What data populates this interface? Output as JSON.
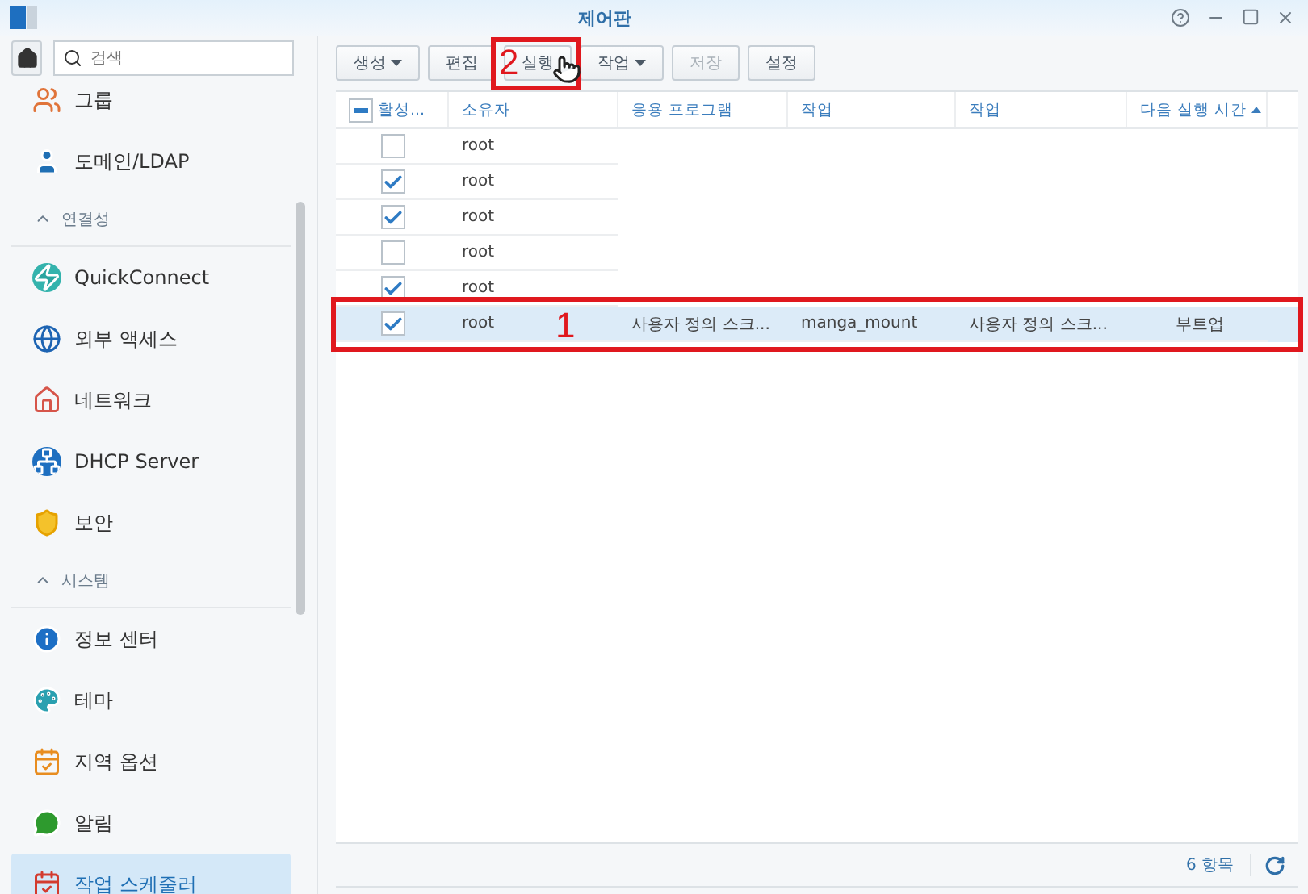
{
  "window": {
    "title": "제어판"
  },
  "search": {
    "placeholder": "검색"
  },
  "sidebar": {
    "items": [
      {
        "kind": "item",
        "label": "그룹",
        "selected": false
      },
      {
        "kind": "item",
        "label": "도메인/LDAP",
        "selected": false
      },
      {
        "kind": "header",
        "label": "연결성"
      },
      {
        "kind": "item",
        "label": "QuickConnect",
        "selected": false
      },
      {
        "kind": "item",
        "label": "외부 액세스",
        "selected": false
      },
      {
        "kind": "item",
        "label": "네트워크",
        "selected": false
      },
      {
        "kind": "item",
        "label": "DHCP Server",
        "selected": false
      },
      {
        "kind": "item",
        "label": "보안",
        "selected": false
      },
      {
        "kind": "header",
        "label": "시스템"
      },
      {
        "kind": "item",
        "label": "정보 센터",
        "selected": false
      },
      {
        "kind": "item",
        "label": "테마",
        "selected": false
      },
      {
        "kind": "item",
        "label": "지역 옵션",
        "selected": false
      },
      {
        "kind": "item",
        "label": "알림",
        "selected": false
      },
      {
        "kind": "item",
        "label": "작업 스케줄러",
        "selected": true
      }
    ]
  },
  "toolbar": {
    "buttons": [
      {
        "label": "생성",
        "dropdown": true,
        "disabled": false
      },
      {
        "label": "편집",
        "dropdown": false,
        "disabled": false
      },
      {
        "label": "실행",
        "dropdown": false,
        "disabled": false
      },
      {
        "label": "작업",
        "dropdown": true,
        "disabled": false
      },
      {
        "label": "저장",
        "dropdown": false,
        "disabled": true
      },
      {
        "label": "설정",
        "dropdown": false,
        "disabled": false
      }
    ]
  },
  "table": {
    "header_partial": true,
    "columns": [
      {
        "label": "활성...",
        "sorted": false
      },
      {
        "label": "소유자",
        "sorted": false
      },
      {
        "label": "응용 프로그램",
        "sorted": false
      },
      {
        "label": "작업",
        "sorted": false
      },
      {
        "label": "작업",
        "sorted": false
      },
      {
        "label": "다음 실행 시간",
        "sorted": true
      }
    ],
    "rows": [
      {
        "active": false,
        "owner": "root",
        "selected": false
      },
      {
        "active": true,
        "owner": "root",
        "selected": false
      },
      {
        "active": true,
        "owner": "root",
        "selected": false
      },
      {
        "active": false,
        "owner": "root",
        "selected": false
      },
      {
        "active": true,
        "owner": "root",
        "selected": false
      },
      {
        "active": true,
        "owner": "root",
        "application": "사용자 정의 스크...",
        "task": "manga_mount",
        "task_2": "사용자 정의 스크...",
        "next_run": "부트업",
        "selected": true
      }
    ]
  },
  "annotations": [
    {
      "label": "1"
    },
    {
      "label": "2"
    }
  ],
  "footer": {
    "count": "6 항목"
  }
}
